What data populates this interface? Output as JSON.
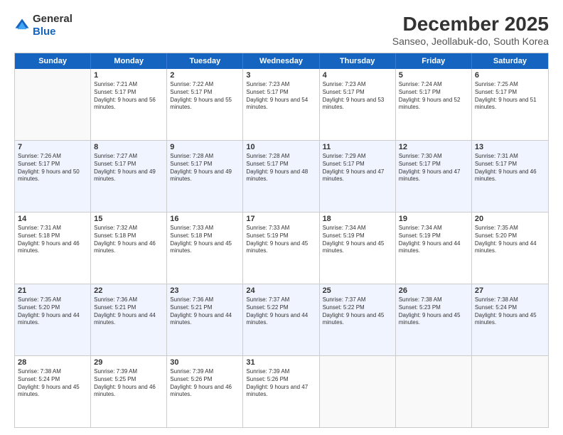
{
  "header": {
    "logo": {
      "general": "General",
      "blue": "Blue"
    },
    "title": "December 2025",
    "subtitle": "Sanseo, Jeollabuk-do, South Korea"
  },
  "calendar": {
    "weekdays": [
      "Sunday",
      "Monday",
      "Tuesday",
      "Wednesday",
      "Thursday",
      "Friday",
      "Saturday"
    ],
    "rows": [
      [
        {
          "day": "",
          "sunrise": "",
          "sunset": "",
          "daylight": ""
        },
        {
          "day": "1",
          "sunrise": "Sunrise: 7:21 AM",
          "sunset": "Sunset: 5:17 PM",
          "daylight": "Daylight: 9 hours and 56 minutes."
        },
        {
          "day": "2",
          "sunrise": "Sunrise: 7:22 AM",
          "sunset": "Sunset: 5:17 PM",
          "daylight": "Daylight: 9 hours and 55 minutes."
        },
        {
          "day": "3",
          "sunrise": "Sunrise: 7:23 AM",
          "sunset": "Sunset: 5:17 PM",
          "daylight": "Daylight: 9 hours and 54 minutes."
        },
        {
          "day": "4",
          "sunrise": "Sunrise: 7:23 AM",
          "sunset": "Sunset: 5:17 PM",
          "daylight": "Daylight: 9 hours and 53 minutes."
        },
        {
          "day": "5",
          "sunrise": "Sunrise: 7:24 AM",
          "sunset": "Sunset: 5:17 PM",
          "daylight": "Daylight: 9 hours and 52 minutes."
        },
        {
          "day": "6",
          "sunrise": "Sunrise: 7:25 AM",
          "sunset": "Sunset: 5:17 PM",
          "daylight": "Daylight: 9 hours and 51 minutes."
        }
      ],
      [
        {
          "day": "7",
          "sunrise": "Sunrise: 7:26 AM",
          "sunset": "Sunset: 5:17 PM",
          "daylight": "Daylight: 9 hours and 50 minutes."
        },
        {
          "day": "8",
          "sunrise": "Sunrise: 7:27 AM",
          "sunset": "Sunset: 5:17 PM",
          "daylight": "Daylight: 9 hours and 49 minutes."
        },
        {
          "day": "9",
          "sunrise": "Sunrise: 7:28 AM",
          "sunset": "Sunset: 5:17 PM",
          "daylight": "Daylight: 9 hours and 49 minutes."
        },
        {
          "day": "10",
          "sunrise": "Sunrise: 7:28 AM",
          "sunset": "Sunset: 5:17 PM",
          "daylight": "Daylight: 9 hours and 48 minutes."
        },
        {
          "day": "11",
          "sunrise": "Sunrise: 7:29 AM",
          "sunset": "Sunset: 5:17 PM",
          "daylight": "Daylight: 9 hours and 47 minutes."
        },
        {
          "day": "12",
          "sunrise": "Sunrise: 7:30 AM",
          "sunset": "Sunset: 5:17 PM",
          "daylight": "Daylight: 9 hours and 47 minutes."
        },
        {
          "day": "13",
          "sunrise": "Sunrise: 7:31 AM",
          "sunset": "Sunset: 5:17 PM",
          "daylight": "Daylight: 9 hours and 46 minutes."
        }
      ],
      [
        {
          "day": "14",
          "sunrise": "Sunrise: 7:31 AM",
          "sunset": "Sunset: 5:18 PM",
          "daylight": "Daylight: 9 hours and 46 minutes."
        },
        {
          "day": "15",
          "sunrise": "Sunrise: 7:32 AM",
          "sunset": "Sunset: 5:18 PM",
          "daylight": "Daylight: 9 hours and 46 minutes."
        },
        {
          "day": "16",
          "sunrise": "Sunrise: 7:33 AM",
          "sunset": "Sunset: 5:18 PM",
          "daylight": "Daylight: 9 hours and 45 minutes."
        },
        {
          "day": "17",
          "sunrise": "Sunrise: 7:33 AM",
          "sunset": "Sunset: 5:19 PM",
          "daylight": "Daylight: 9 hours and 45 minutes."
        },
        {
          "day": "18",
          "sunrise": "Sunrise: 7:34 AM",
          "sunset": "Sunset: 5:19 PM",
          "daylight": "Daylight: 9 hours and 45 minutes."
        },
        {
          "day": "19",
          "sunrise": "Sunrise: 7:34 AM",
          "sunset": "Sunset: 5:19 PM",
          "daylight": "Daylight: 9 hours and 44 minutes."
        },
        {
          "day": "20",
          "sunrise": "Sunrise: 7:35 AM",
          "sunset": "Sunset: 5:20 PM",
          "daylight": "Daylight: 9 hours and 44 minutes."
        }
      ],
      [
        {
          "day": "21",
          "sunrise": "Sunrise: 7:35 AM",
          "sunset": "Sunset: 5:20 PM",
          "daylight": "Daylight: 9 hours and 44 minutes."
        },
        {
          "day": "22",
          "sunrise": "Sunrise: 7:36 AM",
          "sunset": "Sunset: 5:21 PM",
          "daylight": "Daylight: 9 hours and 44 minutes."
        },
        {
          "day": "23",
          "sunrise": "Sunrise: 7:36 AM",
          "sunset": "Sunset: 5:21 PM",
          "daylight": "Daylight: 9 hours and 44 minutes."
        },
        {
          "day": "24",
          "sunrise": "Sunrise: 7:37 AM",
          "sunset": "Sunset: 5:22 PM",
          "daylight": "Daylight: 9 hours and 44 minutes."
        },
        {
          "day": "25",
          "sunrise": "Sunrise: 7:37 AM",
          "sunset": "Sunset: 5:22 PM",
          "daylight": "Daylight: 9 hours and 45 minutes."
        },
        {
          "day": "26",
          "sunrise": "Sunrise: 7:38 AM",
          "sunset": "Sunset: 5:23 PM",
          "daylight": "Daylight: 9 hours and 45 minutes."
        },
        {
          "day": "27",
          "sunrise": "Sunrise: 7:38 AM",
          "sunset": "Sunset: 5:24 PM",
          "daylight": "Daylight: 9 hours and 45 minutes."
        }
      ],
      [
        {
          "day": "28",
          "sunrise": "Sunrise: 7:38 AM",
          "sunset": "Sunset: 5:24 PM",
          "daylight": "Daylight: 9 hours and 45 minutes."
        },
        {
          "day": "29",
          "sunrise": "Sunrise: 7:39 AM",
          "sunset": "Sunset: 5:25 PM",
          "daylight": "Daylight: 9 hours and 46 minutes."
        },
        {
          "day": "30",
          "sunrise": "Sunrise: 7:39 AM",
          "sunset": "Sunset: 5:26 PM",
          "daylight": "Daylight: 9 hours and 46 minutes."
        },
        {
          "day": "31",
          "sunrise": "Sunrise: 7:39 AM",
          "sunset": "Sunset: 5:26 PM",
          "daylight": "Daylight: 9 hours and 47 minutes."
        },
        {
          "day": "",
          "sunrise": "",
          "sunset": "",
          "daylight": ""
        },
        {
          "day": "",
          "sunrise": "",
          "sunset": "",
          "daylight": ""
        },
        {
          "day": "",
          "sunrise": "",
          "sunset": "",
          "daylight": ""
        }
      ]
    ]
  }
}
